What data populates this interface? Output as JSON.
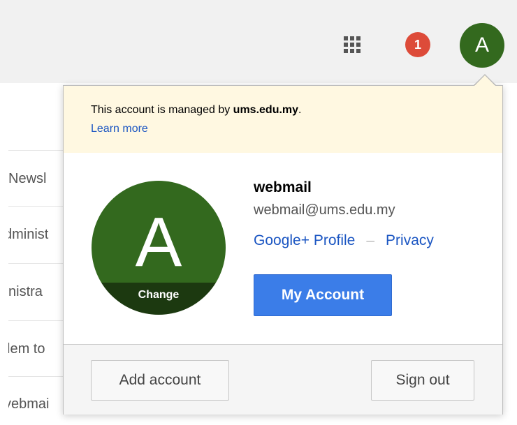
{
  "header": {
    "apps_icon": "apps-grid-icon",
    "notification_count": "1",
    "avatar_letter": "A",
    "colors": {
      "bar_bg": "#f1f1f1",
      "badge": "#dd4b39",
      "avatar": "#33691e"
    }
  },
  "background_list": {
    "rows": [
      {
        "text": "Newsl"
      },
      {
        "text": "dminist"
      },
      {
        "text": "ıinistra"
      },
      {
        "text": "lem to"
      },
      {
        "text": "vebmai"
      }
    ]
  },
  "account_popup": {
    "notice": {
      "text_prefix": "This account is managed by ",
      "domain": "ums.edu.my",
      "text_suffix": ".",
      "learn_more": "Learn more",
      "bg_color": "#fff8e1"
    },
    "avatar": {
      "letter": "A",
      "change_label": "Change"
    },
    "user": {
      "name": "webmail",
      "email": "webmail@ums.edu.my"
    },
    "links": {
      "profile": "Google+ Profile",
      "separator": "–",
      "privacy": "Privacy"
    },
    "my_account_button": "My Account",
    "footer": {
      "add_account": "Add account",
      "sign_out": "Sign out"
    },
    "colors": {
      "link": "#1a55c2",
      "primary_button": "#3b7de8"
    }
  }
}
